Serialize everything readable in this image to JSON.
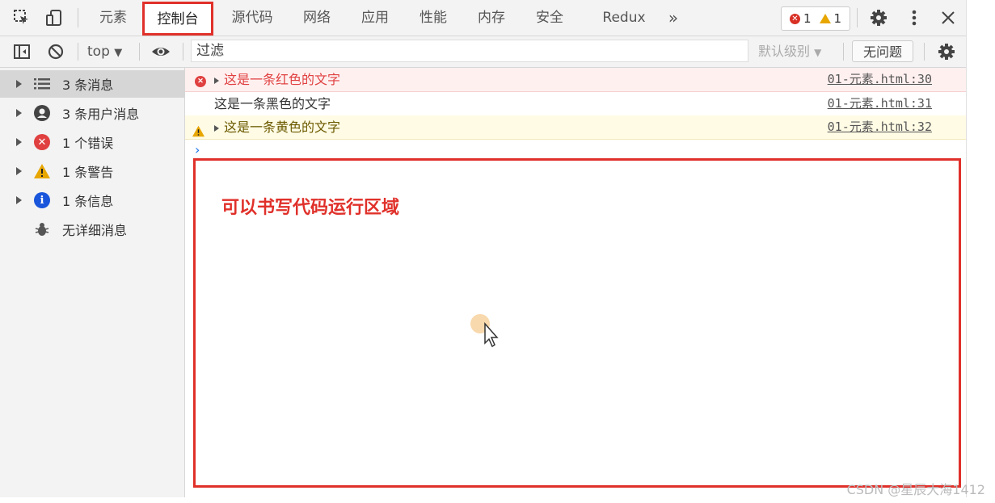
{
  "tabbar": {
    "tabs": [
      "元素",
      "控制台",
      "源代码",
      "网络",
      "应用",
      "性能",
      "内存",
      "安全",
      "Redux"
    ],
    "more": "»",
    "error_count": "1",
    "warning_count": "1"
  },
  "toolbar": {
    "context": "top",
    "filter_placeholder": "过滤",
    "level": "默认级别",
    "no_issues": "无问题"
  },
  "sidebar": {
    "items": [
      {
        "label": "3 条消息",
        "icon": "list-icon"
      },
      {
        "label": "3 条用户消息",
        "icon": "user-icon"
      },
      {
        "label": "1 个错误",
        "icon": "error-icon"
      },
      {
        "label": "1 条警告",
        "icon": "warning-icon"
      },
      {
        "label": "1 条信息",
        "icon": "info-icon"
      },
      {
        "label": "无详细消息",
        "icon": "bug-icon"
      }
    ]
  },
  "console": {
    "messages": [
      {
        "level": "error",
        "text": "这是一条红色的文字",
        "source": "01-元素.html:30"
      },
      {
        "level": "log",
        "text": "这是一条黑色的文字",
        "source": "01-元素.html:31"
      },
      {
        "level": "warning",
        "text": "这是一条黄色的文字",
        "source": "01-元素.html:32"
      }
    ],
    "prompt": "›",
    "annotation": "可以书写代码运行区域"
  },
  "watermark": "CSDN @星辰大海1412",
  "colors": {
    "accent_red": "#e0302a",
    "error": "#d93025",
    "warning": "#e8a600",
    "info": "#1a56db"
  }
}
